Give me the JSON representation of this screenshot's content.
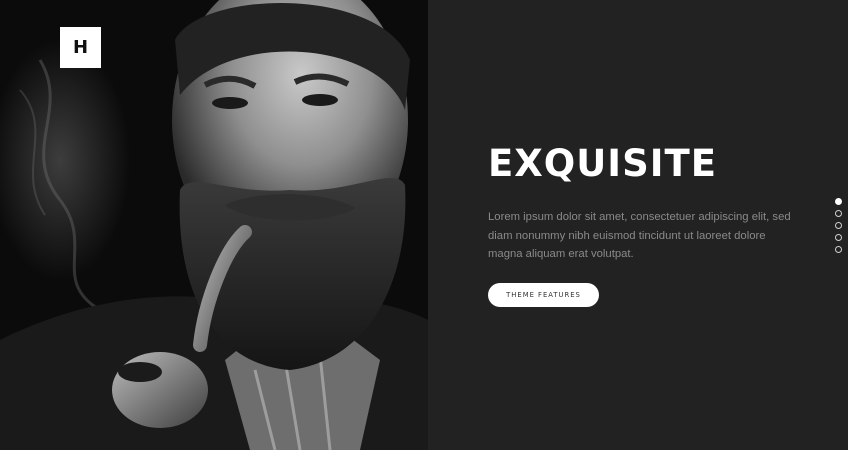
{
  "logo": {
    "letter": "H"
  },
  "hero": {
    "image_alt": "Black and white portrait of a bearded man smoking a pipe"
  },
  "slide": {
    "headline": "EXQUISITE",
    "description": "Lorem ipsum dolor sit amet, consectetuer adipiscing elit, sed diam nonummy nibh euismod tincidunt ut laoreet dolore magna aliquam erat volutpat.",
    "button_label": "THEME FEATURES"
  },
  "pagination": {
    "count": 5,
    "active_index": 0
  },
  "colors": {
    "panel_bg": "#222222",
    "headline": "#ffffff",
    "body_text": "#8a8a8a",
    "button_bg": "#ffffff"
  }
}
